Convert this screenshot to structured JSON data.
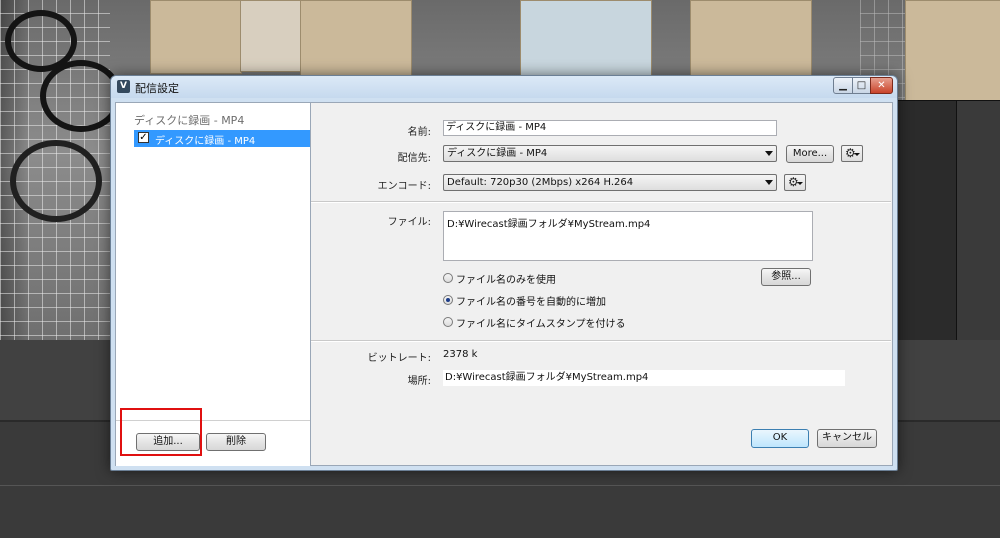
{
  "window": {
    "title": "配信設定"
  },
  "left_pane": {
    "group_header": "ディスクに録画 - MP4",
    "items": [
      {
        "label": "ディスクに録画 - MP4",
        "checked": true,
        "selected": true
      }
    ],
    "add_button": "追加...",
    "delete_button": "削除"
  },
  "form": {
    "name_label": "名前:",
    "name_value": "ディスクに録画 - MP4",
    "destination_label": "配信先:",
    "destination_value": "ディスクに録画 - MP4",
    "more_button": "More...",
    "encoding_label": "エンコード:",
    "encoding_value": "Default: 720p30 (2Mbps) x264 H.264",
    "file_label": "ファイル:",
    "file_value": "D:¥Wirecast録画フォルダ¥MyStream.mp4",
    "browse_button": "参照...",
    "radio_options": [
      {
        "label": "ファイル名のみを使用",
        "selected": false
      },
      {
        "label": "ファイル名の番号を自動的に増加",
        "selected": true
      },
      {
        "label": "ファイル名にタイムスタンプを付ける",
        "selected": false
      }
    ],
    "bitrate_label": "ビットレート:",
    "bitrate_value": "2378 k",
    "location_label": "場所:",
    "location_value": "D:¥Wirecast録画フォルダ¥MyStream.mp4"
  },
  "footer": {
    "ok_button": "OK",
    "cancel_button": "キャンセル"
  },
  "colors": {
    "selection": "#3399ff",
    "highlight_box": "#e01010",
    "title_bar": "#c6d9ee"
  },
  "icons": {
    "app": "wirecast-logo-icon",
    "gear": "gear-icon",
    "dropdown": "chevron-down-icon"
  }
}
